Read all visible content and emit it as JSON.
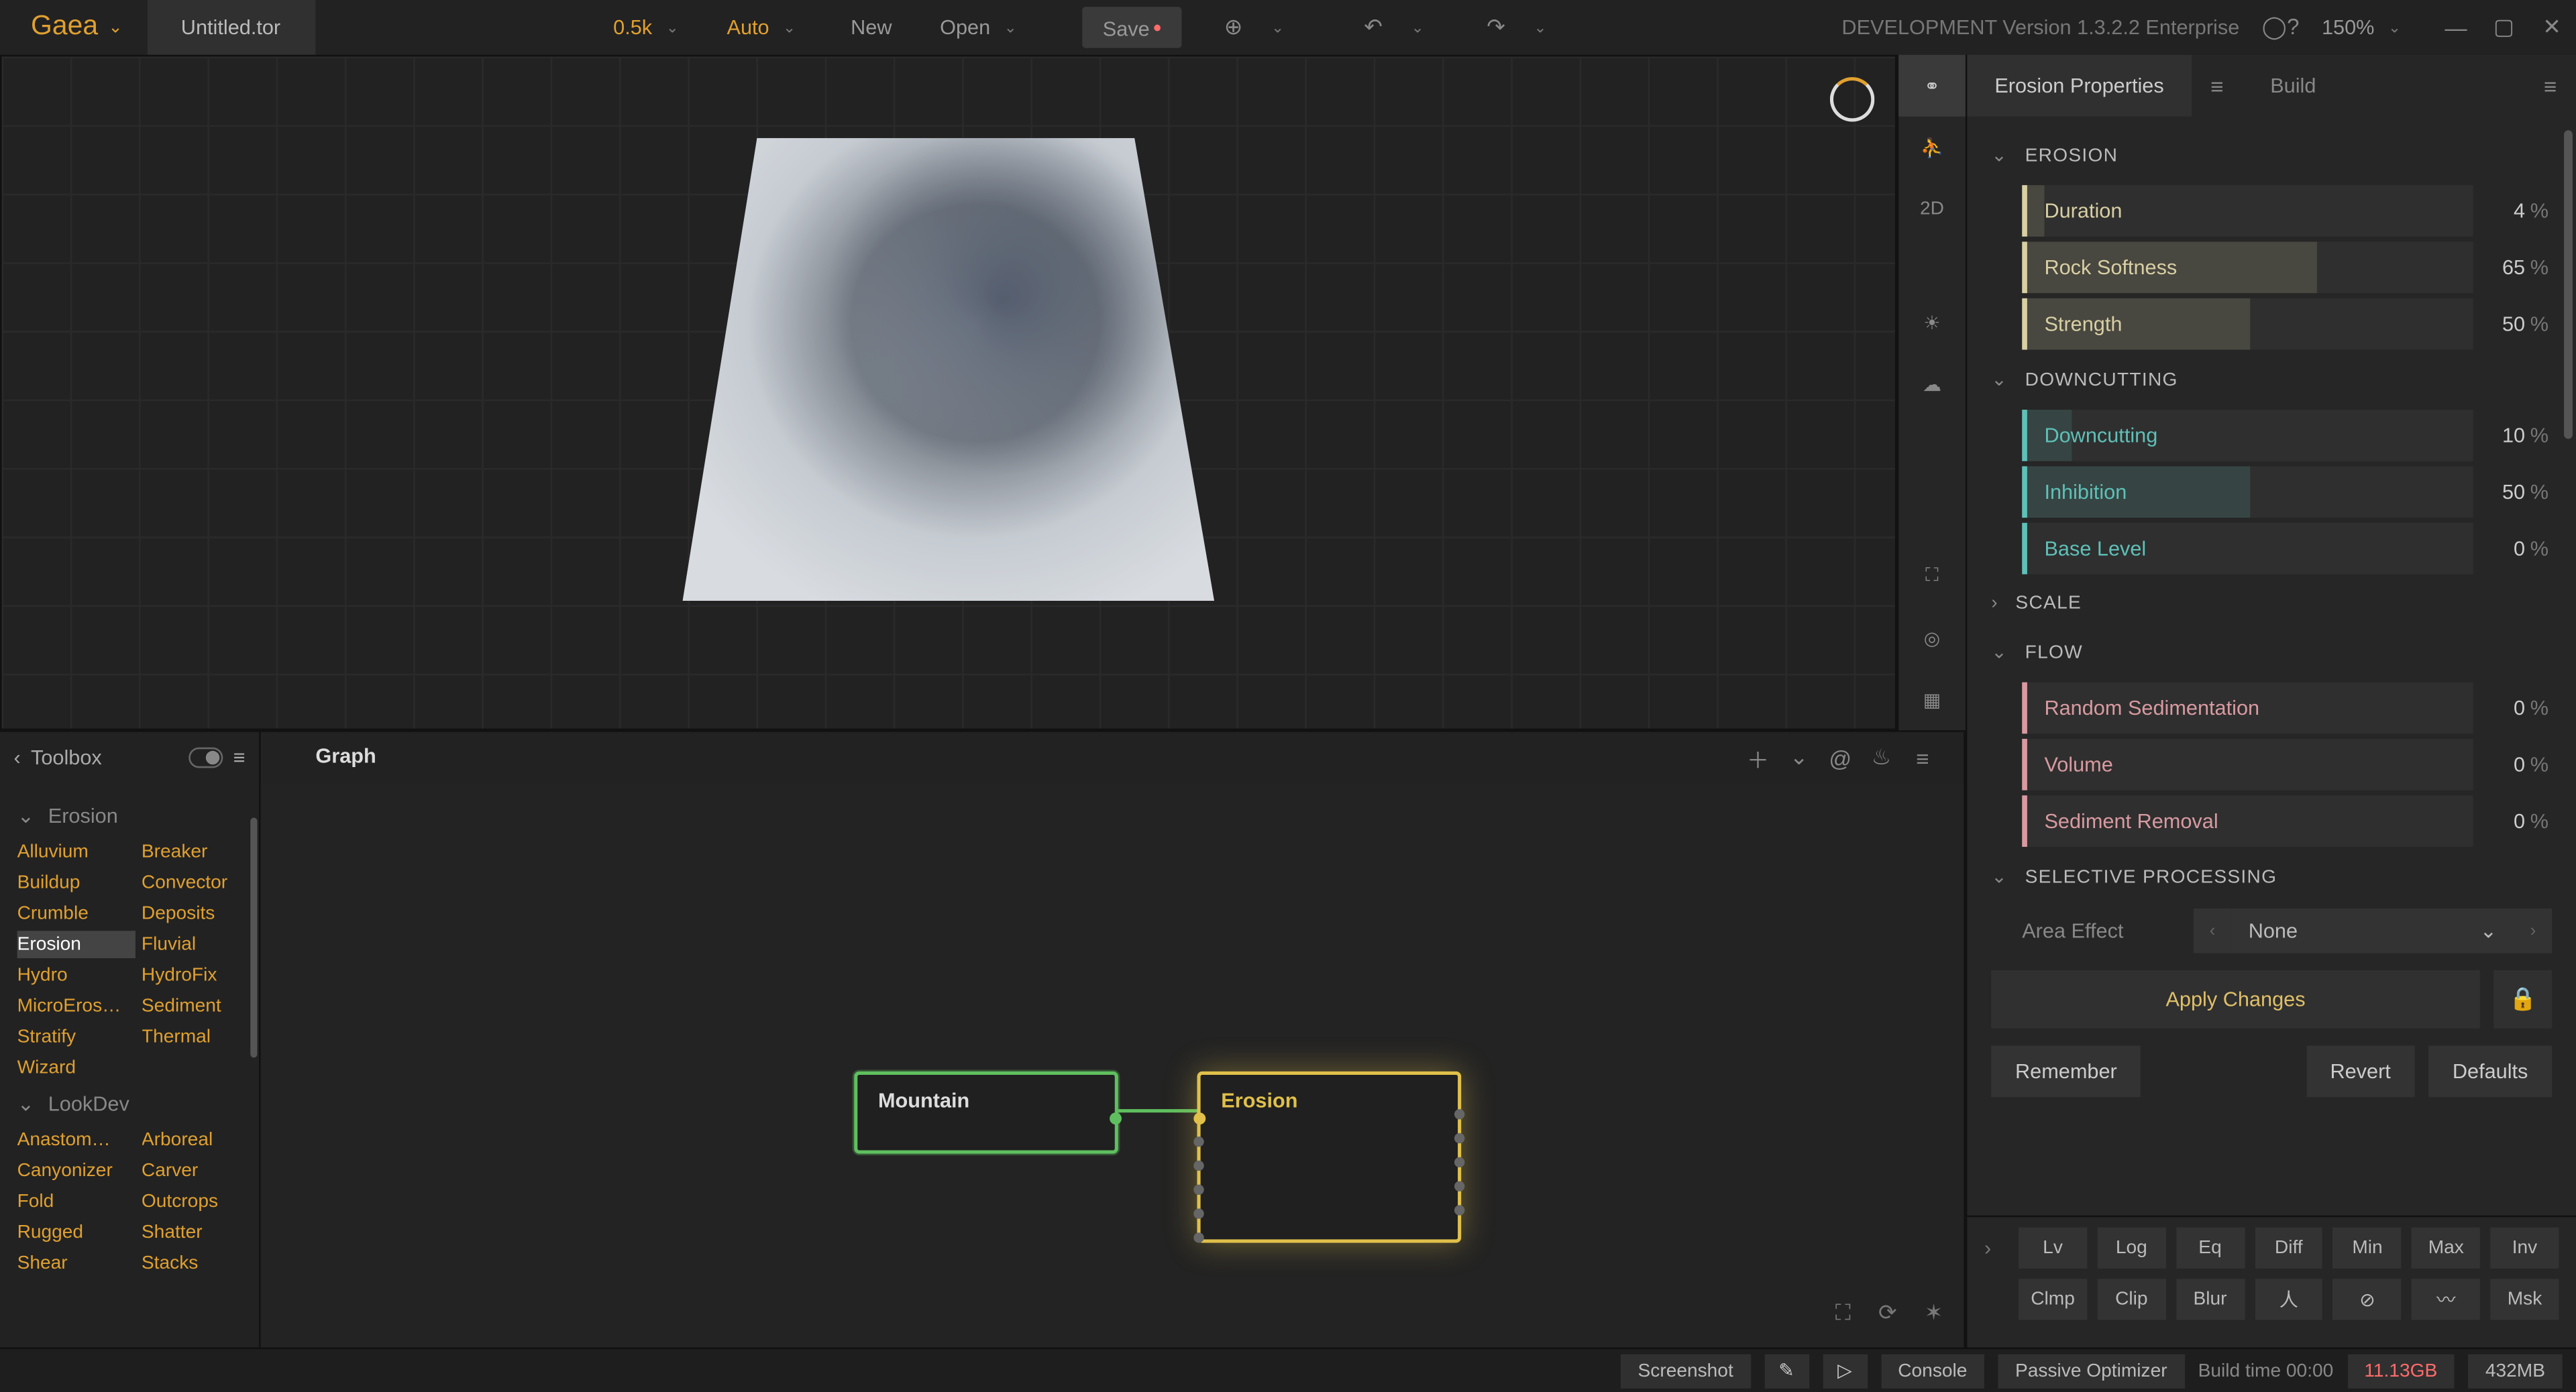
{
  "app": {
    "brand": "Gaea",
    "filename": "Untitled.tor",
    "resolution": "0.5k",
    "mode": "Auto",
    "buttons": {
      "new": "New",
      "open": "Open",
      "save": "Save"
    },
    "dev_text": "DEVELOPMENT Version 1.3.2.2 Enterprise",
    "zoom": "150%"
  },
  "viewport": {
    "side_2d": "2D"
  },
  "toolbox": {
    "title": "Toolbox",
    "sections": [
      {
        "name": "Erosion",
        "items": [
          "Alluvium",
          "Breaker",
          "Buildup",
          "Convector",
          "Crumble",
          "Deposits",
          "Erosion",
          "Fluvial",
          "Hydro",
          "HydroFix",
          "MicroEros…",
          "Sediment",
          "Stratify",
          "Thermal",
          "Wizard",
          ""
        ]
      },
      {
        "name": "LookDev",
        "items": [
          "Anastom…",
          "Arboreal",
          "Canyonizer",
          "Carver",
          "Fold",
          "Outcrops",
          "Rugged",
          "Shatter",
          "Shear",
          "Stacks"
        ]
      }
    ],
    "selected": "Erosion"
  },
  "graph": {
    "tab": "Graph",
    "nodes": {
      "mountain": "Mountain",
      "erosion": "Erosion"
    }
  },
  "right": {
    "tabs": {
      "props": "Erosion Properties",
      "build": "Build"
    },
    "sections": {
      "erosion": {
        "title": "EROSION",
        "sliders": [
          {
            "label": "Duration",
            "value": 4,
            "fill": 4,
            "color": "c-yellow"
          },
          {
            "label": "Rock Softness",
            "value": 65,
            "fill": 65,
            "color": "c-yellow"
          },
          {
            "label": "Strength",
            "value": 50,
            "fill": 50,
            "color": "c-yellow"
          }
        ]
      },
      "downcutting": {
        "title": "DOWNCUTTING",
        "sliders": [
          {
            "label": "Downcutting",
            "value": 10,
            "fill": 10,
            "color": "c-teal"
          },
          {
            "label": "Inhibition",
            "value": 50,
            "fill": 50,
            "color": "c-teal"
          },
          {
            "label": "Base Level",
            "value": 0,
            "fill": 0,
            "color": "c-teal"
          }
        ]
      },
      "scale": {
        "title": "SCALE",
        "collapsed": true
      },
      "flow": {
        "title": "FLOW",
        "sliders": [
          {
            "label": "Random Sedimentation",
            "value": 0,
            "fill": 0,
            "color": "c-pink"
          },
          {
            "label": "Volume",
            "value": 0,
            "fill": 0,
            "color": "c-pink"
          },
          {
            "label": "Sediment Removal",
            "value": 0,
            "fill": 0,
            "color": "c-pink"
          }
        ]
      },
      "selective": {
        "title": "SELECTIVE PROCESSING",
        "area_label": "Area Effect",
        "area_value": "None"
      }
    },
    "apply": "Apply Changes",
    "footer": {
      "remember": "Remember",
      "revert": "Revert",
      "defaults": "Defaults"
    },
    "mini": [
      [
        "Lv",
        "Log",
        "Eq",
        "Diff",
        "Min",
        "Max",
        "Inv"
      ],
      [
        "Clmp",
        "Clip",
        "Blur",
        "人",
        "⊘",
        "〰",
        "Msk"
      ]
    ]
  },
  "status": {
    "screenshot": "Screenshot",
    "console": "Console",
    "passive": "Passive Optimizer",
    "build_time": "Build time 00:00",
    "mem_red": "11.13GB",
    "mem": "432MB"
  }
}
